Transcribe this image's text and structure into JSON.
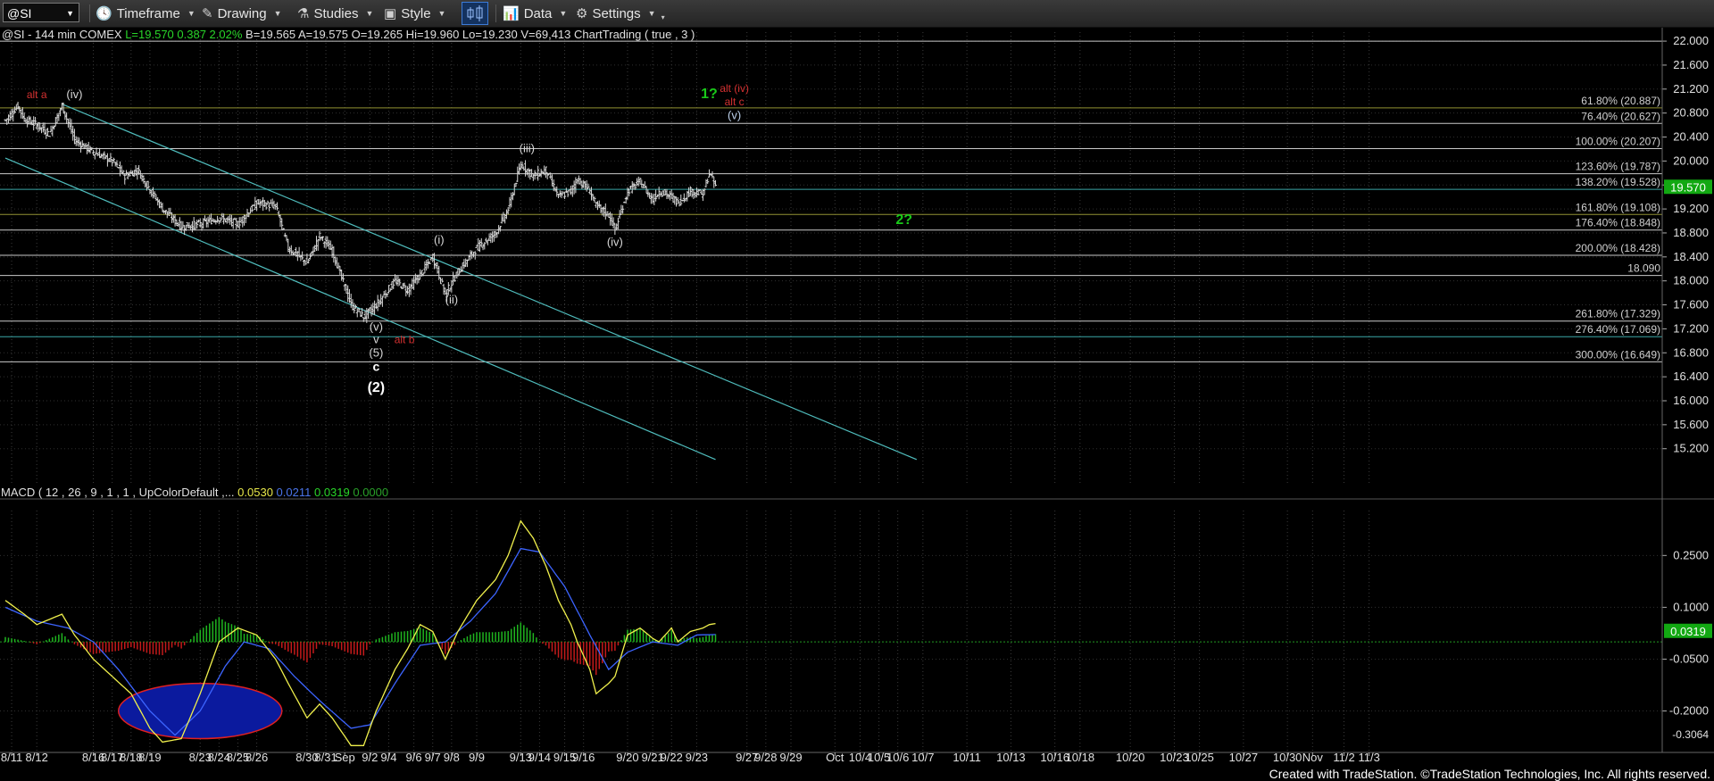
{
  "toolbar": {
    "symbol": "@SI",
    "timeframe": "Timeframe",
    "drawing": "Drawing",
    "studies": "Studies",
    "style": "Style",
    "data": "Data",
    "settings": "Settings"
  },
  "footer": "Created with TradeStation. ©TradeStation Technologies, Inc. All rights reserved.",
  "chart_data": [
    {
      "type": "candlestick",
      "title": "",
      "header": {
        "name": "@SI - 144 min  COMEX",
        "last": "L=19.570",
        "change": "0.387",
        "pct": "2.02%",
        "bid": "B=19.565",
        "ask": "A=19.575",
        "open": "O=19.265",
        "high": "Hi=19.960",
        "low": "Lo=19.230",
        "volume": "V=69,413",
        "study": "ChartTrading ( true , 3 )"
      },
      "ylim": [
        14.6,
        22.15
      ],
      "y_ticks": [
        15.2,
        15.6,
        16.0,
        16.4,
        16.8,
        17.2,
        17.6,
        18.0,
        18.4,
        18.8,
        19.2,
        19.6,
        20.0,
        20.4,
        20.8,
        21.2,
        21.6,
        22.0
      ],
      "y_tick_labels": [
        "15.200",
        "15.600",
        "16.000",
        "16.400",
        "16.800",
        "17.200",
        "17.600",
        "18.000",
        "18.400",
        "18.800",
        "19.200",
        "19.600",
        "20.000",
        "20.400",
        "20.800",
        "21.200",
        "21.600",
        "22.000"
      ],
      "last_price": 19.57,
      "last_label": "19.570",
      "x_labels": [
        {
          "i": 1,
          "t": "8/11"
        },
        {
          "i": 5,
          "t": "8/12"
        },
        {
          "i": 14,
          "t": "8/16"
        },
        {
          "i": 17,
          "t": "8/17"
        },
        {
          "i": 20,
          "t": "8/18"
        },
        {
          "i": 23,
          "t": "8/19"
        },
        {
          "i": 31,
          "t": "8/23"
        },
        {
          "i": 34,
          "t": "8/24"
        },
        {
          "i": 37,
          "t": "8/25"
        },
        {
          "i": 40,
          "t": "8/26"
        },
        {
          "i": 48,
          "t": "8/30"
        },
        {
          "i": 51,
          "t": "8/31"
        },
        {
          "i": 54,
          "t": "Sep"
        },
        {
          "i": 58,
          "t": "9/2"
        },
        {
          "i": 61,
          "t": "9/4"
        },
        {
          "i": 65,
          "t": "9/6"
        },
        {
          "i": 68,
          "t": "9/7"
        },
        {
          "i": 71,
          "t": "9/8"
        },
        {
          "i": 75,
          "t": "9/9"
        },
        {
          "i": 82,
          "t": "9/13"
        },
        {
          "i": 85,
          "t": "9/14"
        },
        {
          "i": 89,
          "t": "9/15"
        },
        {
          "i": 92,
          "t": "9/16"
        },
        {
          "i": 99,
          "t": "9/20"
        },
        {
          "i": 103,
          "t": "9/21"
        },
        {
          "i": 106,
          "t": "9/22"
        },
        {
          "i": 110,
          "t": "9/23"
        },
        {
          "i": 118,
          "t": "9/27"
        },
        {
          "i": 121,
          "t": "9/28"
        },
        {
          "i": 125,
          "t": "9/29"
        },
        {
          "i": 132,
          "t": "Oct"
        },
        {
          "i": 136,
          "t": "10/4"
        },
        {
          "i": 139,
          "t": "10/5"
        },
        {
          "i": 142,
          "t": "10/6"
        },
        {
          "i": 146,
          "t": "10/7"
        },
        {
          "i": 153,
          "t": "10/11"
        },
        {
          "i": 160,
          "t": "10/13"
        },
        {
          "i": 167,
          "t": "10/16"
        },
        {
          "i": 171,
          "t": "10/18"
        },
        {
          "i": 179,
          "t": "10/20"
        },
        {
          "i": 186,
          "t": "10/23"
        },
        {
          "i": 190,
          "t": "10/25"
        },
        {
          "i": 197,
          "t": "10/27"
        },
        {
          "i": 204,
          "t": "10/30"
        },
        {
          "i": 208,
          "t": "Nov"
        },
        {
          "i": 213,
          "t": "11/2"
        },
        {
          "i": 217,
          "t": "11/3"
        }
      ],
      "anchors": [
        [
          0,
          20.68
        ],
        [
          2,
          20.92
        ],
        [
          3,
          20.7
        ],
        [
          5,
          20.6
        ],
        [
          7,
          20.45
        ],
        [
          9,
          20.92
        ],
        [
          11,
          20.35
        ],
        [
          14,
          20.15
        ],
        [
          17,
          20.0
        ],
        [
          19,
          19.75
        ],
        [
          21,
          19.85
        ],
        [
          25,
          19.2
        ],
        [
          28,
          18.9
        ],
        [
          31,
          18.95
        ],
        [
          34,
          19.05
        ],
        [
          37,
          18.95
        ],
        [
          40,
          19.3
        ],
        [
          43,
          19.25
        ],
        [
          45,
          18.55
        ],
        [
          48,
          18.3
        ],
        [
          50,
          18.75
        ],
        [
          52,
          18.5
        ],
        [
          55,
          17.6
        ],
        [
          57,
          17.4
        ],
        [
          59,
          17.6
        ],
        [
          62,
          18.0
        ],
        [
          64,
          17.85
        ],
        [
          66,
          18.1
        ],
        [
          68,
          18.4
        ],
        [
          70,
          17.78
        ],
        [
          72,
          18.15
        ],
        [
          75,
          18.55
        ],
        [
          78,
          18.8
        ],
        [
          80,
          19.2
        ],
        [
          82,
          19.95
        ],
        [
          84,
          19.75
        ],
        [
          86,
          19.85
        ],
        [
          88,
          19.4
        ],
        [
          90,
          19.5
        ],
        [
          91,
          19.7
        ],
        [
          93,
          19.5
        ],
        [
          94,
          19.25
        ],
        [
          96,
          19.1
        ],
        [
          97,
          18.85
        ],
        [
          99,
          19.5
        ],
        [
          101,
          19.65
        ],
        [
          103,
          19.35
        ],
        [
          104,
          19.5
        ],
        [
          106,
          19.4
        ],
        [
          107,
          19.3
        ],
        [
          109,
          19.5
        ],
        [
          111,
          19.45
        ],
        [
          112,
          19.8
        ],
        [
          113,
          19.57
        ]
      ],
      "horizontal_levels": [
        {
          "y": 22.0,
          "label": "",
          "color": "#c9c9c9"
        },
        {
          "y": 20.887,
          "label": "61.80% (20.887)",
          "color": "#8f8f32"
        },
        {
          "y": 20.627,
          "label": "76.40% (20.627)",
          "color": "#c9c9c9"
        },
        {
          "y": 20.207,
          "label": "100.00% (20.207)",
          "color": "#c9c9c9"
        },
        {
          "y": 19.787,
          "label": "123.60% (19.787)",
          "color": "#c9c9c9"
        },
        {
          "y": 19.528,
          "label": "138.20% (19.528)",
          "color": "#3aa7a7"
        },
        {
          "y": 19.108,
          "label": "161.80% (19.108)",
          "color": "#8f8f32"
        },
        {
          "y": 18.848,
          "label": "176.40% (18.848)",
          "color": "#c9c9c9"
        },
        {
          "y": 18.428,
          "label": "200.00% (18.428)",
          "color": "#c9c9c9"
        },
        {
          "y": 18.09,
          "label": "18.090",
          "color": "#c9c9c9"
        },
        {
          "y": 17.329,
          "label": "261.80% (17.329)",
          "color": "#c9c9c9"
        },
        {
          "y": 17.069,
          "label": "276.40% (17.069)",
          "color": "#3aa7a7"
        },
        {
          "y": 16.649,
          "label": "300.00% (16.649)",
          "color": "#c9c9c9"
        }
      ],
      "channel_lines": [
        {
          "from": [
            0,
            20.05
          ],
          "to": [
            113,
            15.02
          ],
          "color": "#4fbcbc"
        },
        {
          "from": [
            9,
            20.95
          ],
          "to": [
            145,
            15.02
          ],
          "color": "#4fbcbc"
        }
      ],
      "wave_labels": [
        {
          "i": 5,
          "y": 21.05,
          "t": "alt a",
          "color": "#d33030",
          "size": 12
        },
        {
          "i": 11,
          "y": 21.05,
          "t": "(iv)",
          "color": "#d8d8d8",
          "size": 13
        },
        {
          "i": 112,
          "y": 21.05,
          "t": "1?",
          "color": "#19c919",
          "size": 16,
          "bold": true
        },
        {
          "i": 116,
          "y": 21.15,
          "t": "alt (iv)",
          "color": "#d33030",
          "size": 12
        },
        {
          "i": 116,
          "y": 20.93,
          "t": "alt c",
          "color": "#d33030",
          "size": 12
        },
        {
          "i": 116,
          "y": 20.7,
          "t": "(v)",
          "color": "#bcd0ea",
          "size": 13
        },
        {
          "i": 83,
          "y": 20.15,
          "t": "(iii)",
          "color": "#d8d8d8",
          "size": 13
        },
        {
          "i": 69,
          "y": 18.62,
          "t": "(i)",
          "color": "#d8d8d8",
          "size": 13
        },
        {
          "i": 97,
          "y": 18.58,
          "t": "(iv)",
          "color": "#d8d8d8",
          "size": 13
        },
        {
          "i": 71,
          "y": 17.62,
          "t": "(ii)",
          "color": "#d8d8d8",
          "size": 13
        },
        {
          "i": 143,
          "y": 18.95,
          "t": "2?",
          "color": "#19c919",
          "size": 16,
          "bold": true
        },
        {
          "i": 59,
          "y": 17.17,
          "t": "(v)",
          "color": "#d8d8d8",
          "size": 13
        },
        {
          "i": 59,
          "y": 16.96,
          "t": "v",
          "color": "#d8d8d8",
          "size": 13
        },
        {
          "i": 59,
          "y": 16.74,
          "t": "(5)",
          "color": "#d8d8d8",
          "size": 13
        },
        {
          "i": 59,
          "y": 16.5,
          "t": "c",
          "color": "#ffffff",
          "size": 14,
          "bold": true
        },
        {
          "i": 63.5,
          "y": 16.96,
          "t": "alt b",
          "color": "#d33030",
          "size": 12
        },
        {
          "i": 59,
          "y": 16.15,
          "t": "(2)",
          "color": "#ffffff",
          "size": 16,
          "bold": true
        }
      ]
    },
    {
      "type": "macd",
      "title": "",
      "header": {
        "study": "MACD ( 12 , 26 , 9 , 1 , 1 , UpColorDefault ,...",
        "macd": "0.0530",
        "signal": "0.0211",
        "diff": "0.0319",
        "zero": "0.0000"
      },
      "ylim": [
        -0.32,
        0.38
      ],
      "y_ticks": [
        0.25,
        0.1,
        -0.05,
        -0.2
      ],
      "y_tick_labels": [
        "0.2500",
        "0.1000",
        "-0.0500",
        "-0.2000"
      ],
      "bottom_label": "-0.3064",
      "last_value": 0.0319,
      "last_label": "0.0319",
      "macd_anchors": [
        [
          0,
          0.12
        ],
        [
          3,
          0.08
        ],
        [
          5,
          0.05
        ],
        [
          9,
          0.08
        ],
        [
          11,
          0.02
        ],
        [
          14,
          -0.05
        ],
        [
          17,
          -0.1
        ],
        [
          20,
          -0.15
        ],
        [
          23,
          -0.25
        ],
        [
          25,
          -0.29
        ],
        [
          28,
          -0.28
        ],
        [
          31,
          -0.15
        ],
        [
          34,
          0.0
        ],
        [
          37,
          0.04
        ],
        [
          40,
          0.02
        ],
        [
          43,
          -0.05
        ],
        [
          45,
          -0.12
        ],
        [
          48,
          -0.22
        ],
        [
          50,
          -0.18
        ],
        [
          52,
          -0.22
        ],
        [
          55,
          -0.3
        ],
        [
          57,
          -0.3
        ],
        [
          59,
          -0.2
        ],
        [
          62,
          -0.08
        ],
        [
          64,
          -0.02
        ],
        [
          66,
          0.05
        ],
        [
          68,
          0.03
        ],
        [
          70,
          -0.05
        ],
        [
          72,
          0.03
        ],
        [
          75,
          0.12
        ],
        [
          78,
          0.18
        ],
        [
          80,
          0.25
        ],
        [
          82,
          0.35
        ],
        [
          84,
          0.3
        ],
        [
          86,
          0.22
        ],
        [
          88,
          0.12
        ],
        [
          90,
          0.05
        ],
        [
          91,
          0.0
        ],
        [
          93,
          -0.08
        ],
        [
          94,
          -0.15
        ],
        [
          96,
          -0.12
        ],
        [
          97,
          -0.1
        ],
        [
          99,
          0.02
        ],
        [
          101,
          0.04
        ],
        [
          103,
          0.01
        ],
        [
          104,
          0.0
        ],
        [
          106,
          0.04
        ],
        [
          107,
          0.0
        ],
        [
          109,
          0.03
        ],
        [
          111,
          0.04
        ],
        [
          112,
          0.05
        ],
        [
          113,
          0.053
        ]
      ],
      "signal_anchors": [
        [
          0,
          0.1
        ],
        [
          5,
          0.06
        ],
        [
          10,
          0.04
        ],
        [
          14,
          0.0
        ],
        [
          18,
          -0.08
        ],
        [
          23,
          -0.2
        ],
        [
          27,
          -0.27
        ],
        [
          31,
          -0.2
        ],
        [
          35,
          -0.07
        ],
        [
          38,
          0.0
        ],
        [
          42,
          -0.02
        ],
        [
          46,
          -0.1
        ],
        [
          50,
          -0.17
        ],
        [
          55,
          -0.25
        ],
        [
          58,
          -0.24
        ],
        [
          62,
          -0.12
        ],
        [
          66,
          -0.01
        ],
        [
          70,
          0.0
        ],
        [
          74,
          0.06
        ],
        [
          78,
          0.14
        ],
        [
          82,
          0.27
        ],
        [
          85,
          0.26
        ],
        [
          89,
          0.16
        ],
        [
          93,
          0.02
        ],
        [
          96,
          -0.08
        ],
        [
          99,
          -0.03
        ],
        [
          103,
          0.0
        ],
        [
          107,
          -0.01
        ],
        [
          110,
          0.02
        ],
        [
          113,
          0.0211
        ]
      ],
      "ellipse": {
        "cx": 31,
        "cy": -0.2,
        "rx": 13,
        "ry": 0.08
      }
    }
  ]
}
